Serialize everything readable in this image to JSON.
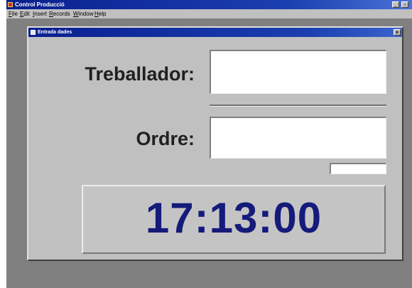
{
  "app": {
    "title": "Control Producció",
    "min_glyph": "_",
    "restore_glyph": "▫"
  },
  "menubar": {
    "items": [
      "File",
      "Edit",
      "Insert",
      "Records",
      "Window",
      "Help"
    ]
  },
  "dialog": {
    "title": "Entrada dades",
    "close_glyph": "×",
    "worker_label": "Treballador:",
    "worker_value": "",
    "order_label": "Ordre:",
    "order_value": "",
    "small_value": "",
    "clock": "17:13:00"
  },
  "colors": {
    "title_bar": "#0a1f8f",
    "clock_text": "#151b7a",
    "window_face": "#c0c0c0"
  }
}
